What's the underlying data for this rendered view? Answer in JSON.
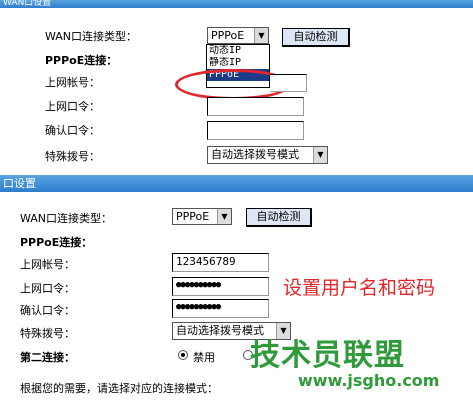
{
  "panel1": {
    "header": "WAN口设置",
    "wan_type_label": "WAN口连接类型：",
    "wan_type_value": "PPPoE",
    "auto_detect": "自动检测",
    "pppoe_label": "PPPoE连接：",
    "username_label": "上网帐号：",
    "password_label": "上网口令：",
    "confirm_label": "确认口令：",
    "dial_label": "特殊拨号：",
    "dial_value": "自动选择拨号模式",
    "dropdown_options": [
      "动态IP",
      "静态IP",
      "PPPoE"
    ]
  },
  "panel2": {
    "header": "口设置",
    "wan_type_label": "WAN口连接类型：",
    "wan_type_value": "PPPoE",
    "auto_detect": "自动检测",
    "pppoe_label": "PPPoE连接：",
    "username_label": "上网帐号：",
    "username_value": "123456789",
    "password_label": "上网口令：",
    "password_value": "●●●●●●●●●●",
    "confirm_label": "确认口令：",
    "confirm_value": "●●●●●●●●●●",
    "dial_label": "特殊拨号：",
    "dial_value": "自动选择拨号模式",
    "second_conn_label": "第二连接：",
    "second_conn_option": "禁用",
    "hint_text": "根据您的需要，请选择对应的连接模式：",
    "annotation": "设置用户名和密码"
  },
  "watermark": {
    "title": "技术员联盟",
    "url": "www.jsgho.com"
  },
  "colors": {
    "header": "#2e7ccb",
    "highlight": "#e0272b",
    "watermark": "#2e9a3a",
    "selection": "#1a3a8a"
  }
}
